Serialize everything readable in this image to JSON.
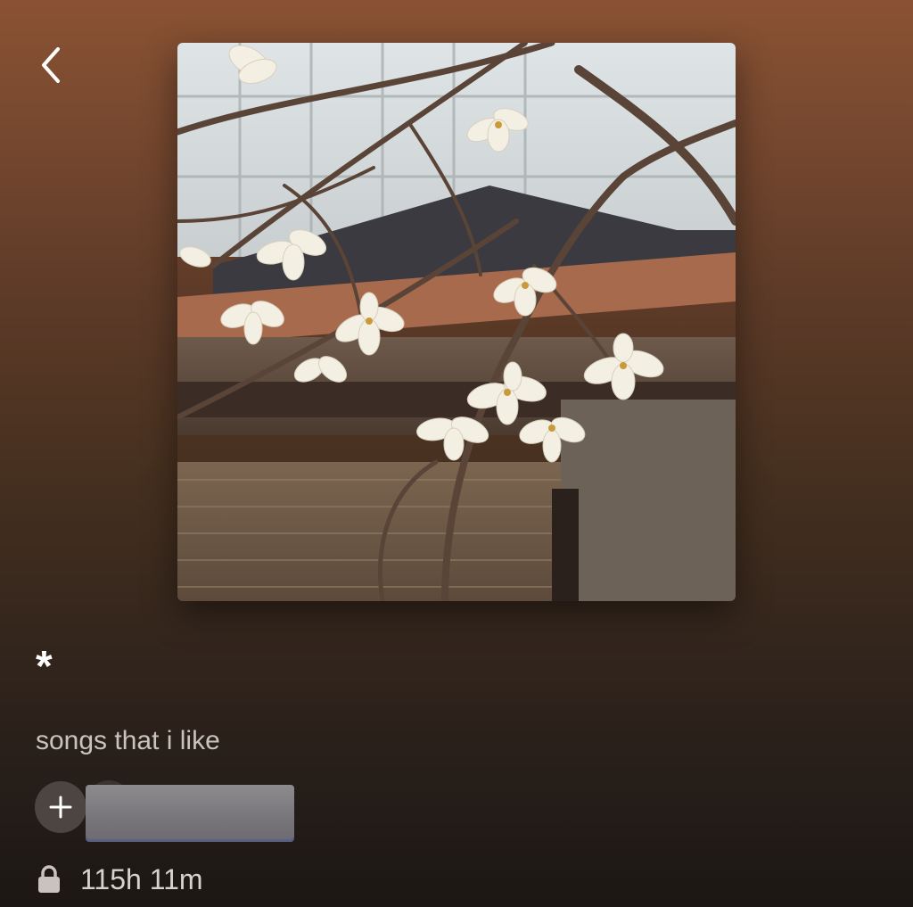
{
  "header": {
    "back_icon": "chevron-left-icon"
  },
  "cover": {
    "description_icon": "album-cover-image"
  },
  "playlist": {
    "title": "*",
    "description": "songs that i like",
    "duration": "115h 11m",
    "visibility_icon": "lock-icon",
    "add_icon": "plus-icon"
  },
  "colors": {
    "background_top": "#8a5233",
    "background_bottom": "#1c1714",
    "description_text": "#c9c2bd",
    "add_button_bg": "#4d4541"
  }
}
